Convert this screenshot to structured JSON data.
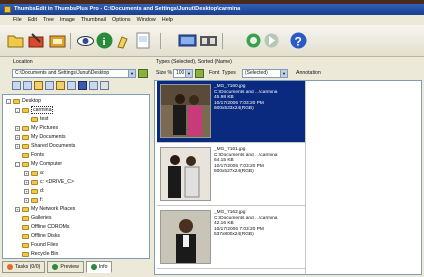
{
  "window": {
    "title": "ThumbsEdit in ThumbsPlus Pro - C:\\Documents and Settings\\Junut\\Desktop\\carmina"
  },
  "menu": [
    "File",
    "Edit",
    "Tree",
    "Image",
    "Thumbnail",
    "Options",
    "Window",
    "Help"
  ],
  "toolbar": {
    "icons": [
      "open-folder-icon",
      "edit-icon",
      "slideshow-icon",
      "eye-icon",
      "info-icon",
      "paint-icon",
      "page-icon",
      "monitor-icon",
      "filmstrip-icon",
      "refresh-icon",
      "forward-icon",
      "help-icon"
    ]
  },
  "location": {
    "label": "Location",
    "value": "C:\\Documents and Settings\\Junut\\Desktop"
  },
  "types_header": "Types (Selected), Sorted (Name)",
  "size": {
    "label": "Size %",
    "value": "100"
  },
  "font_label": "Font",
  "types": {
    "label": "Types",
    "value": "(Selected)"
  },
  "annotation_label": "Annotation",
  "tree": [
    {
      "label": "Desktop",
      "level": 0,
      "expand": "-"
    },
    {
      "label": "carmina",
      "level": 1,
      "expand": "-",
      "selected": true
    },
    {
      "label": "test",
      "level": 2,
      "expand": ""
    },
    {
      "label": "My Pictures",
      "level": 1,
      "expand": "+"
    },
    {
      "label": "My Documents",
      "level": 1,
      "expand": "+"
    },
    {
      "label": "Shared Documents",
      "level": 1,
      "expand": "+"
    },
    {
      "label": "Fonts",
      "level": 1,
      "expand": ""
    },
    {
      "label": "My Computer",
      "level": 1,
      "expand": "-"
    },
    {
      "label": "a:",
      "level": 2,
      "expand": "+"
    },
    {
      "label": "c: <DRIVE_C>",
      "level": 2,
      "expand": "+"
    },
    {
      "label": "d:",
      "level": 2,
      "expand": "+"
    },
    {
      "label": "f:",
      "level": 2,
      "expand": "+"
    },
    {
      "label": "My Network Places",
      "level": 1,
      "expand": "+"
    },
    {
      "label": "Galleries",
      "level": 1,
      "expand": ""
    },
    {
      "label": "Offline CDROMs",
      "level": 1,
      "expand": ""
    },
    {
      "label": "Offline Disks",
      "level": 1,
      "expand": ""
    },
    {
      "label": "Found Files",
      "level": 1,
      "expand": ""
    },
    {
      "label": "Recycle Bin",
      "level": 1,
      "expand": ""
    }
  ],
  "tabs": [
    {
      "label": "Tasks (0/0)",
      "color": "#e06a2a"
    },
    {
      "label": "Preview",
      "color": "#2a8a3a"
    },
    {
      "label": "Info",
      "color": "#2a8a3a",
      "active": true
    }
  ],
  "thumbnails": [
    {
      "name": "_MG_7160.jpg",
      "path": "C:\\Documents and ...\\carmina",
      "size": "45.98 KB",
      "date": "10/17/2006  7:03:20 PM",
      "dims": "600x533x24(RGB)",
      "selected": true
    },
    {
      "name": "_MG_7161.jpg",
      "path": "C:\\Documents and ...\\carmina",
      "size": "64.15 KB",
      "date": "10/17/2006  7:03:20 PM",
      "dims": "600x527x24(RGB)",
      "selected": false
    },
    {
      "name": "_MG_7162.jpg",
      "path": "C:\\Documents and ...\\carmina",
      "size": "42.16 KB",
      "date": "10/17/2006  7:03:20 PM",
      "dims": "537x800x24(RGB)",
      "selected": false
    }
  ]
}
